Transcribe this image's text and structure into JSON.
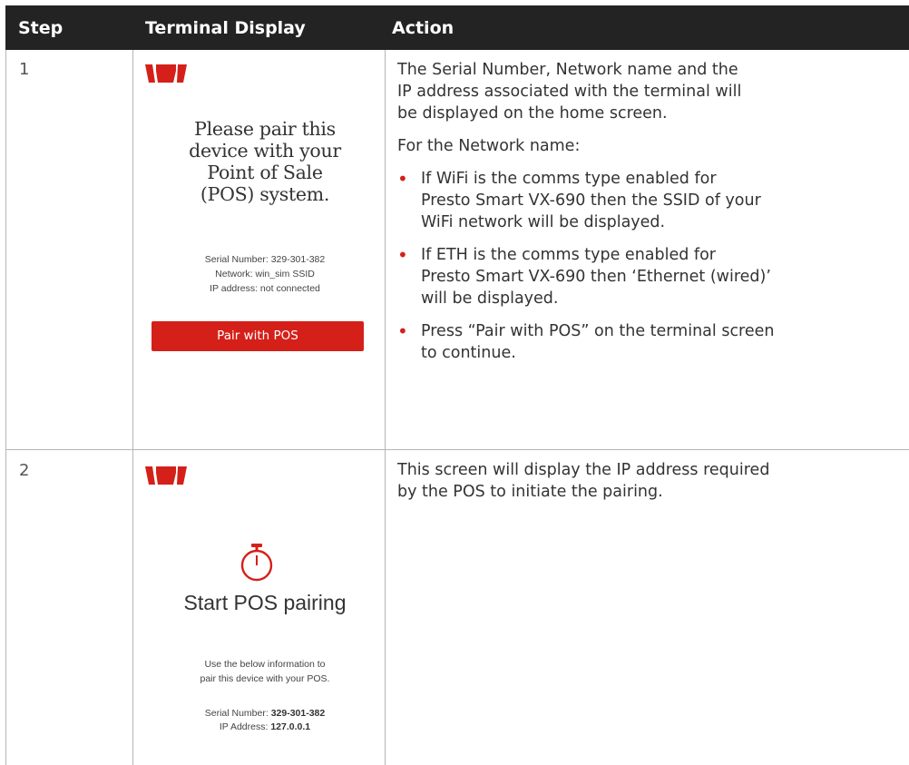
{
  "header": {
    "step": "Step",
    "display": "Terminal Display",
    "action": "Action"
  },
  "colors": {
    "header_bg": "#232323",
    "accent_red": "#d5201a",
    "rule": "#b5b5b5"
  },
  "rows": [
    {
      "step": "1",
      "display": {
        "logo": "westpac-logo",
        "title_lines": [
          "Please pair this",
          "device with your",
          "Point of Sale",
          "(POS) system."
        ],
        "info_lines": [
          "Serial Number: 329-301-382",
          "Network: win_sim SSID",
          "IP address: not connected"
        ],
        "button": "Pair with POS"
      },
      "action": {
        "intro_lines": [
          "The Serial Number, Network name and the",
          "IP address associated with the terminal will",
          "be displayed on the home screen."
        ],
        "lead": "For the Network name:",
        "bullets": [
          [
            "If WiFi is the comms type enabled for",
            "Presto Smart VX-690 then the SSID of your",
            "WiFi network will be displayed."
          ],
          [
            "If ETH is the comms type enabled for",
            "Presto Smart VX-690 then ‘Ethernet (wired)’",
            "will be displayed."
          ],
          [
            "Press “Pair with POS” on the terminal screen",
            "to continue."
          ]
        ]
      }
    },
    {
      "step": "2",
      "display": {
        "logo": "westpac-logo",
        "icon": "stopwatch-icon",
        "title": "Start POS pairing",
        "info_lines": [
          "Use the below information to",
          "pair this device with your POS."
        ],
        "serial_label": "Serial Number: ",
        "serial_value": "329-301-382",
        "ip_label": "IP Address: ",
        "ip_value": "127.0.0.1"
      },
      "action": {
        "intro_lines": [
          "This screen will display the IP address required",
          "by the POS to initiate the pairing."
        ]
      }
    }
  ]
}
